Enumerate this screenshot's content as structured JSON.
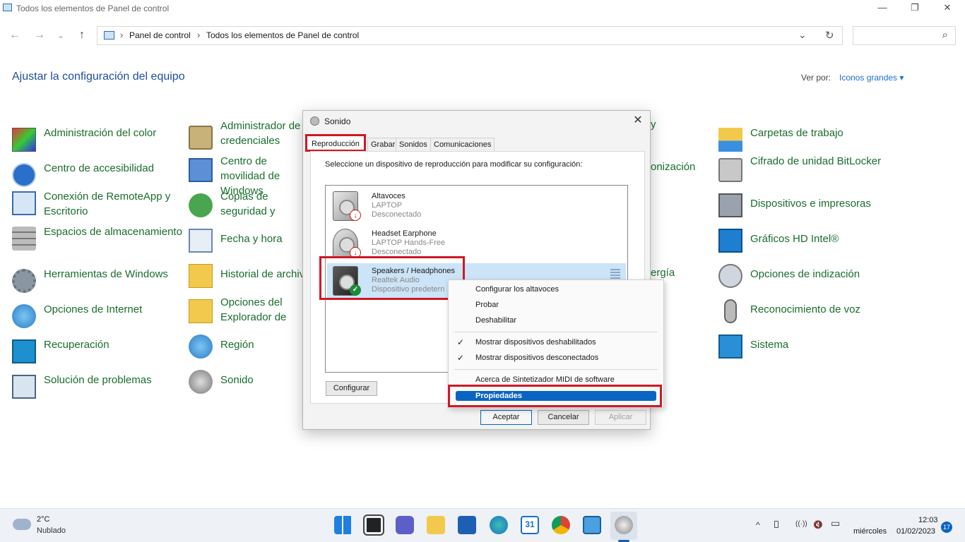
{
  "window": {
    "title": "Todos los elementos de Panel de control",
    "minimize": "—",
    "restore": "❐",
    "close": "✕"
  },
  "nav": {
    "back": "←",
    "forward": "→",
    "recent": "⌄",
    "up": "↑",
    "breadcrumb": [
      "Panel de control",
      "Todos los elementos de Panel de control"
    ],
    "dropdown": "⌄",
    "refresh": "↻",
    "search_icon": "⌕"
  },
  "page": {
    "heading": "Ajustar la configuración del equipo",
    "view_by_label": "Ver por:",
    "view_by_value": "Iconos grandes ▾"
  },
  "items": {
    "col1": [
      "Administración del color",
      "Centro de accesibilidad",
      "Conexión de RemoteApp y Escritorio",
      "Espacios de almacenamiento",
      "Herramientas de Windows",
      "Opciones de Internet",
      "Recuperación",
      "Solución de problemas"
    ],
    "col2": [
      "Administrador de credenciales",
      "Centro de movilidad de Windows",
      "Copias de seguridad y restauración (W...",
      "Fecha y hora",
      "Historial de archivos",
      "Opciones del Explorador de archivos",
      "Región",
      "Sonido"
    ],
    "col3_partial": [
      "y",
      "onización",
      "ergía"
    ],
    "col5": [
      "Carpetas de trabajo",
      "Cifrado de unidad BitLocker",
      "Dispositivos e impresoras",
      "Gráficos HD Intel®",
      "Opciones de indización",
      "Reconocimiento de voz",
      "Sistema"
    ]
  },
  "dialog": {
    "title": "Sonido",
    "close": "✕",
    "tabs": [
      "Reproducción",
      "Grabar",
      "Sonidos",
      "Comunicaciones"
    ],
    "instruction": "Seleccione un dispositivo de reproducción para modificar su configuración:",
    "devices": [
      {
        "name": "Altavoces",
        "sub": "LAPTOP",
        "status": "Desconectado",
        "badge": "↓"
      },
      {
        "name": "Headset Earphone",
        "sub": "LAPTOP Hands-Free",
        "status": "Desconectado",
        "badge": "↓"
      },
      {
        "name": "Speakers / Headphones",
        "sub": "Realtek Audio",
        "status": "Dispositivo predetern",
        "badge": "✓"
      }
    ],
    "configure_button": "Configurar",
    "ok_button": "Aceptar",
    "cancel_button": "Cancelar",
    "apply_button": "Aplicar"
  },
  "context_menu": {
    "items": [
      "Configurar los altavoces",
      "Probar",
      "Deshabilitar",
      "Mostrar dispositivos deshabilitados",
      "Mostrar dispositivos desconectados",
      "Acerca de Sintetizador MIDI de software",
      "Propiedades"
    ],
    "check": "✓"
  },
  "taskbar": {
    "temperature": "2°C",
    "condition": "Nublado",
    "time": "12:03",
    "day": "miércoles",
    "date": "01/02/2023",
    "notifications": "17",
    "calendar_day": "31",
    "tray_up": "^",
    "tray_wifi": "((·))",
    "tray_sound": "🔇",
    "tray_battery": "▭"
  },
  "colors": {
    "link_green": "#1a6d2e",
    "heading_blue": "#1f4e9e",
    "highlight_red": "#d01824",
    "selection_blue": "#0a64c2"
  }
}
